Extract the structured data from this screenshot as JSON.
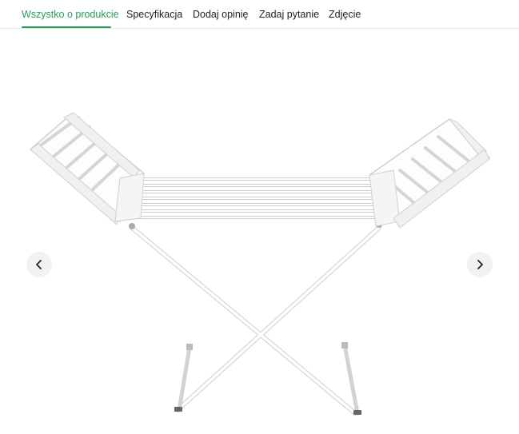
{
  "tabs": [
    {
      "label": "Wszystko o produkcie",
      "active": true
    },
    {
      "label": "Specyfikacja",
      "active": false
    },
    {
      "label": "Dodaj opinię",
      "active": false
    },
    {
      "label": "Zadaj pytanie",
      "active": false
    },
    {
      "label": "Zdjęcie",
      "active": false
    }
  ],
  "colors": {
    "accent": "#2a9a5a",
    "nav_bg": "#f2f2f2"
  },
  "gallery": {
    "prev_icon": "chevron-left-icon",
    "next_icon": "chevron-right-icon"
  }
}
